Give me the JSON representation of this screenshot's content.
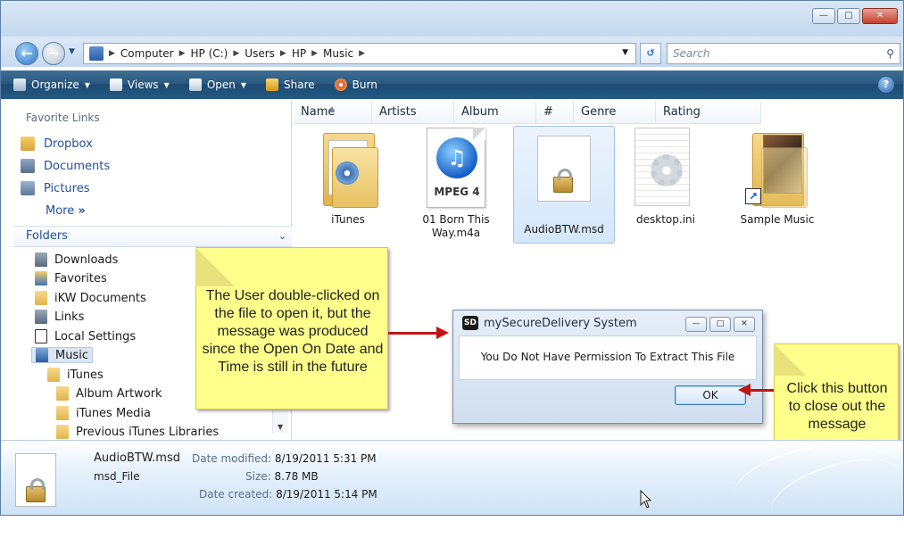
{
  "address": {
    "crumbs": [
      "Computer",
      "HP (C:)",
      "Users",
      "HP",
      "Music"
    ],
    "search_placeholder": "Search"
  },
  "toolbar": {
    "organize": "Organize",
    "views": "Views",
    "open": "Open",
    "share": "Share",
    "burn": "Burn"
  },
  "sidebar": {
    "favorite_links_heading": "Favorite Links",
    "favorites": [
      "Dropbox",
      "Documents",
      "Pictures"
    ],
    "more": "More",
    "folders_heading": "Folders",
    "tree": [
      "Downloads",
      "Favorites",
      "iKW Documents",
      "Links",
      "Local Settings",
      "Music",
      "iTunes",
      "Album Artwork",
      "iTunes Media",
      "Previous iTunes Libraries"
    ]
  },
  "columns": [
    "Name",
    "Artists",
    "Album",
    "#",
    "Genre",
    "Rating"
  ],
  "files": [
    {
      "label": "iTunes"
    },
    {
      "label": "01 Born This Way.m4a",
      "badge": "MPEG 4"
    },
    {
      "label": "AudioBTW.msd"
    },
    {
      "label": "desktop.ini"
    },
    {
      "label": "Sample Music"
    }
  ],
  "callout_left": "The User double-clicked on the file to open it, but the message was produced since the Open On Date and Time is still in the future",
  "callout_right": "Click this button to close out the message",
  "dialog": {
    "icon_text": "SD",
    "title": "mySecureDelivery System",
    "message": "You Do Not Have Permission To Extract This File",
    "ok": "OK"
  },
  "details": {
    "filename": "AudioBTW.msd",
    "filetype": "msd_File",
    "modified_label": "Date modified:",
    "modified_value": "8/19/2011 5:31 PM",
    "size_label": "Size:",
    "size_value": "8.78 MB",
    "created_label": "Date created:",
    "created_value": "8/19/2011 5:14 PM"
  }
}
